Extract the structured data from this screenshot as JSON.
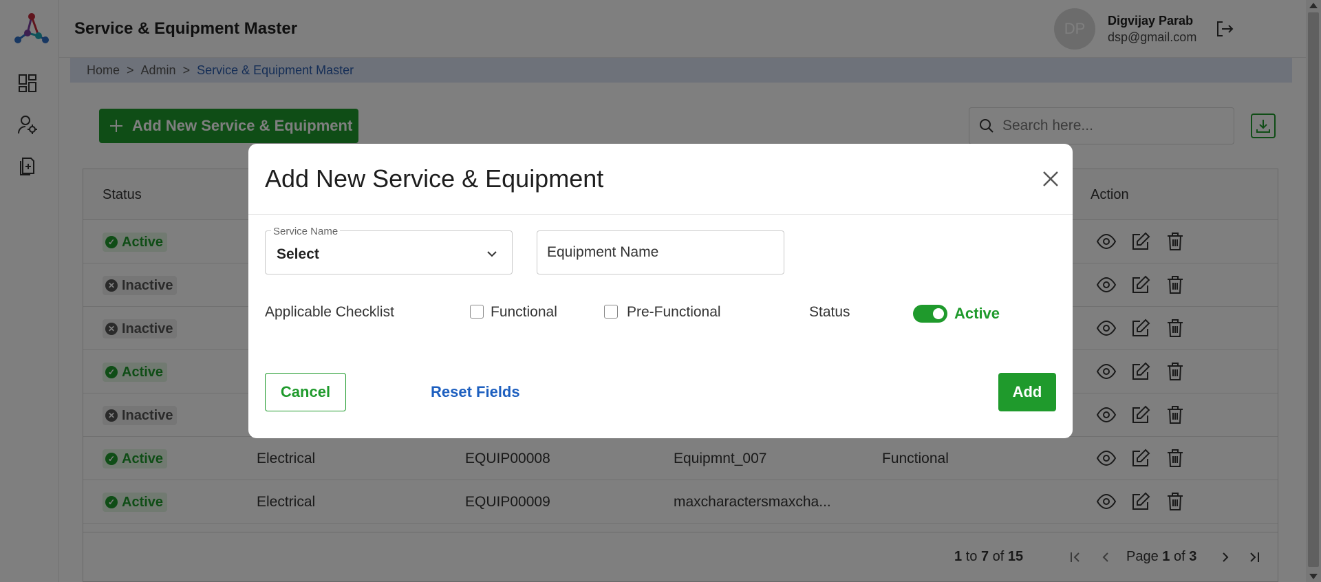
{
  "header": {
    "title": "Service & Equipment Master",
    "avatar_initials": "DP",
    "user_name": "Digvijay Parab",
    "user_email": "dsp@gmail.com"
  },
  "breadcrumb": {
    "items": [
      "Home",
      "Admin",
      "Service & Equipment Master"
    ],
    "separator": ">"
  },
  "toolbar": {
    "add_button_label": "Add New Service & Equipment",
    "search_placeholder": "Search here..."
  },
  "table": {
    "headers": {
      "status": "Status",
      "action": "Action"
    },
    "rows": [
      {
        "status": "Active",
        "service": "",
        "equipment_id": "",
        "equipment_name": "",
        "checklist": ""
      },
      {
        "status": "Inactive",
        "service": "",
        "equipment_id": "",
        "equipment_name": "",
        "checklist": ""
      },
      {
        "status": "Inactive",
        "service": "",
        "equipment_id": "",
        "equipment_name": "",
        "checklist": ""
      },
      {
        "status": "Active",
        "service": "",
        "equipment_id": "",
        "equipment_name": "",
        "checklist": ""
      },
      {
        "status": "Inactive",
        "service": "",
        "equipment_id": "",
        "equipment_name": "",
        "checklist": ""
      },
      {
        "status": "Active",
        "service": "Electrical",
        "equipment_id": "EQUIP00008",
        "equipment_name": "Equipmnt_007",
        "checklist": "Functional"
      },
      {
        "status": "Active",
        "service": "Electrical",
        "equipment_id": "EQUIP00009",
        "equipment_name": "maxcharactersmaxcha...",
        "checklist": ""
      }
    ]
  },
  "pagination": {
    "from": "1",
    "to_word": "to",
    "to": "7",
    "of_word": "of",
    "total": "15",
    "page_word": "Page",
    "page": "1",
    "pages": "3"
  },
  "modal": {
    "title": "Add New Service & Equipment",
    "service_name_label": "Service Name",
    "service_name_value": "Select",
    "equipment_name_placeholder": "Equipment Name",
    "checklist_label": "Applicable Checklist",
    "option_functional": "Functional",
    "option_pre_functional": "Pre-Functional",
    "status_label": "Status",
    "status_value": "Active",
    "cancel_label": "Cancel",
    "reset_label": "Reset Fields",
    "add_label": "Add"
  },
  "colors": {
    "brand_green": "#1f9a2c",
    "link_blue": "#1d5fbf",
    "breadcrumb_bg": "#dde4f4"
  }
}
